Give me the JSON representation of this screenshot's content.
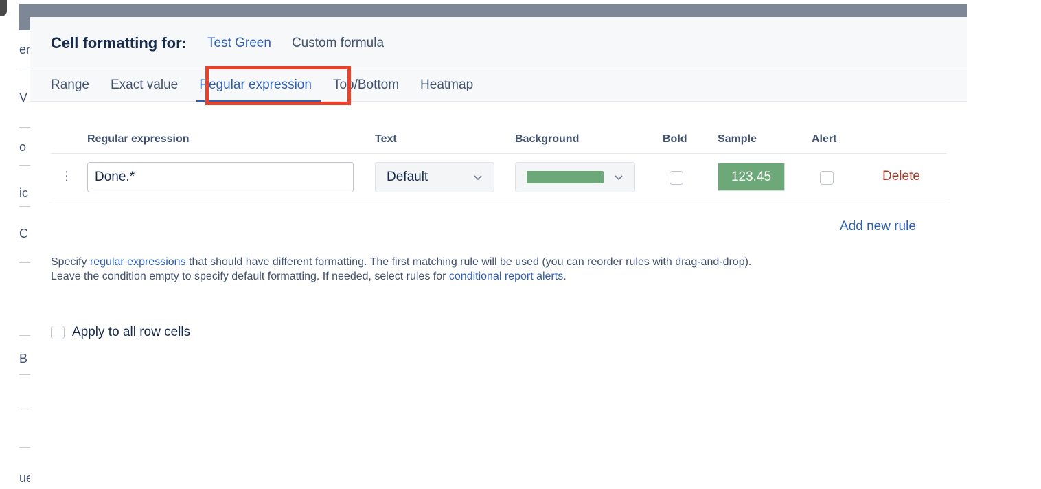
{
  "background": {
    "fragments": [
      "er",
      "V",
      "o",
      "ic",
      "C",
      "B",
      "ue"
    ]
  },
  "modal": {
    "title": "Cell formatting for:",
    "header_link": "Test Green",
    "header_custom": "Custom formula"
  },
  "tabs": [
    {
      "label": "Range",
      "active": false
    },
    {
      "label": "Exact value",
      "active": false
    },
    {
      "label": "Regular expression",
      "active": true
    },
    {
      "label": "Top/Bottom",
      "active": false
    },
    {
      "label": "Heatmap",
      "active": false
    }
  ],
  "table": {
    "headers": {
      "regex": "Regular expression",
      "text": "Text",
      "background": "Background",
      "bold": "Bold",
      "sample": "Sample",
      "alert": "Alert"
    },
    "rows": [
      {
        "drag_handle": "⋮",
        "regex_value": "Done.*",
        "text_option": "Default",
        "background_color": "#6da878",
        "bold": false,
        "sample": "123.45",
        "alert": false,
        "delete_label": "Delete"
      }
    ]
  },
  "add_rule_label": "Add new rule",
  "help": {
    "p1_before": "Specify ",
    "p1_link": "regular expressions",
    "p1_after": " that should have different formatting. The first matching rule will be used (you can reorder rules with drag-and-drop).",
    "p2_before": "Leave the condition empty to specify default formatting. If needed, select rules for ",
    "p2_link": "conditional report alerts",
    "p2_after": "."
  },
  "apply_all_label": "Apply to all row cells",
  "colors": {
    "accent": "#2f5fb3",
    "danger": "#a43f2e",
    "highlight": "#e8412c",
    "green": "#6da878"
  }
}
